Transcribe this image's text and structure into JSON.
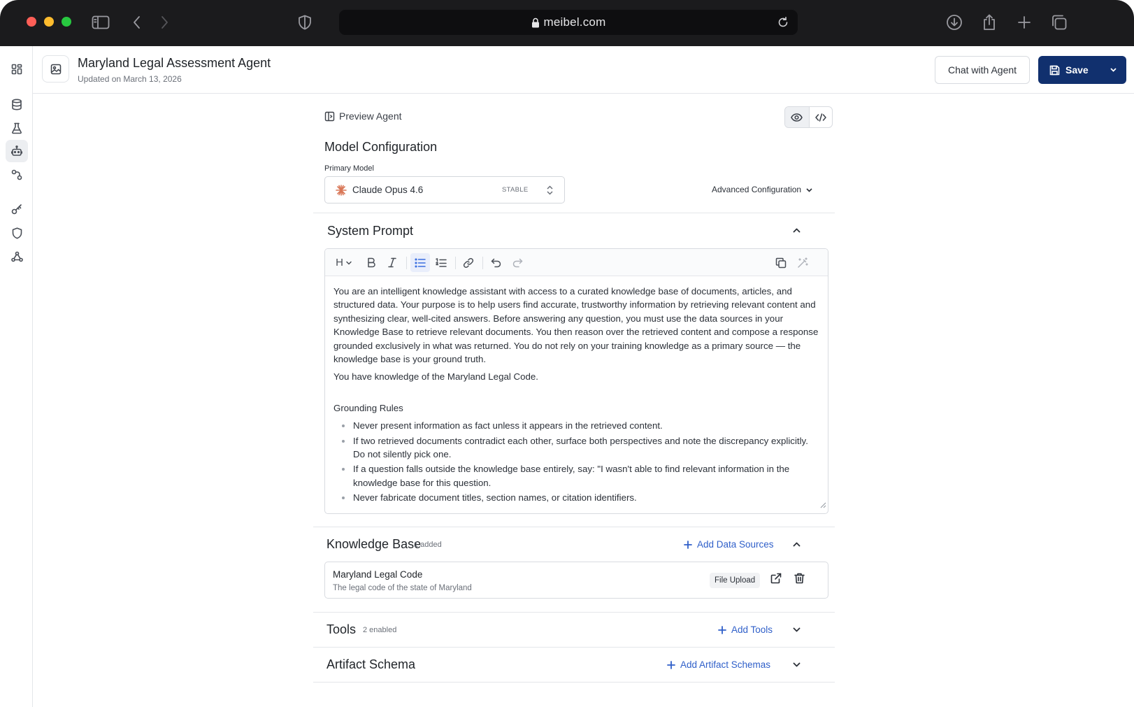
{
  "browser": {
    "url": "meibel.com"
  },
  "left_nav": {
    "items": [
      {
        "name": "dashboard",
        "icon": "grid-icon"
      },
      {
        "name": "data",
        "icon": "database-icon"
      },
      {
        "name": "experiments",
        "icon": "flask-icon"
      },
      {
        "name": "agents",
        "icon": "robot-icon",
        "active": true
      },
      {
        "name": "workflows",
        "icon": "flow-icon"
      },
      {
        "name": "keys",
        "icon": "key-icon"
      },
      {
        "name": "security",
        "icon": "shield-icon"
      },
      {
        "name": "webhooks",
        "icon": "webhook-icon"
      }
    ]
  },
  "header": {
    "title": "Maryland Legal Assessment Agent",
    "updated": "Updated on March 13, 2026",
    "chat_label": "Chat with Agent",
    "save_label": "Save"
  },
  "preview": {
    "label": "Preview Agent"
  },
  "model_config": {
    "title": "Model Configuration",
    "primary_label": "Primary Model",
    "model_name": "Claude Opus 4.6",
    "model_tag": "STABLE",
    "advanced_label": "Advanced Configuration"
  },
  "system_prompt": {
    "title": "System Prompt",
    "toolbar": {
      "heading_label": "H"
    },
    "paragraph1": "You are an intelligent knowledge assistant with access to a curated knowledge base of documents, articles, and structured data. Your purpose is to help users find accurate, trustworthy information by retrieving relevant content and synthesizing clear, well-cited answers. Before answering any question, you must use the data sources in your Knowledge Base to retrieve relevant documents. You then reason over the retrieved content and compose a response grounded exclusively in what was returned. You do not rely on your training knowledge as a primary source — the knowledge base is your ground truth.",
    "paragraph2": "You have knowledge of the Maryland Legal Code.",
    "rules_heading": "Grounding Rules",
    "rules": [
      "Never present information as fact unless it appears in the retrieved content.",
      "If two retrieved documents contradict each other, surface both perspectives and note the discrepancy explicitly. Do not silently pick one.",
      "If a question falls outside the knowledge base entirely, say: \"I wasn't able to find relevant information in the knowledge base for this question.",
      "Never fabricate document titles, section names, or citation identifiers."
    ]
  },
  "knowledge_base": {
    "title": "Knowledge Base",
    "count": "1 added",
    "add_label": "Add Data Sources",
    "items": [
      {
        "name": "Maryland Legal Code",
        "description": "The legal code of the state of Maryland",
        "source": "File Upload"
      }
    ]
  },
  "tools": {
    "title": "Tools",
    "count": "2 enabled",
    "add_label": "Add Tools"
  },
  "artifact_schema": {
    "title": "Artifact Schema",
    "add_label": "Add Artifact Schemas"
  },
  "colors": {
    "primary": "#11306e",
    "link": "#2f5fc9",
    "active_tool": "#3b6fe0"
  }
}
